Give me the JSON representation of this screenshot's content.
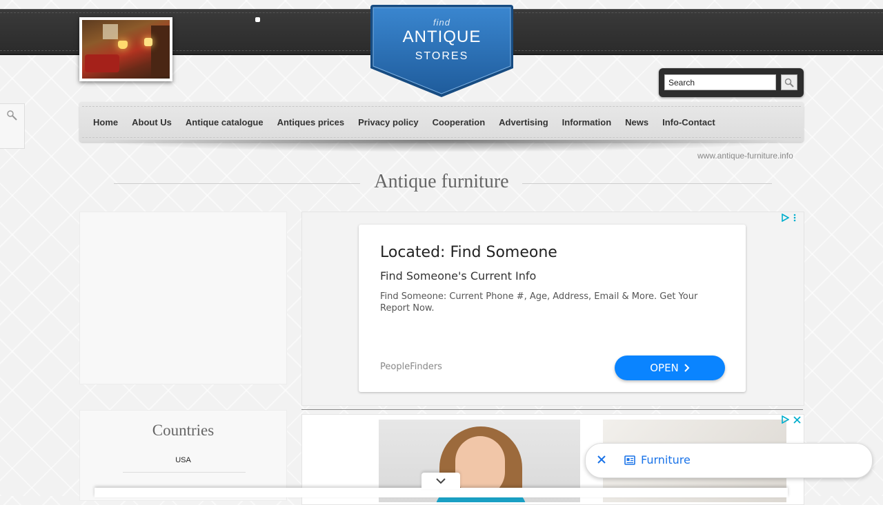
{
  "logo": {
    "find": "find",
    "antique": "ANTIQUE",
    "stores": "STORES"
  },
  "search": {
    "value": "Search"
  },
  "nav": {
    "items": [
      "Home",
      "About Us",
      "Antique catalogue",
      "Antiques prices",
      "Privacy policy",
      "Cooperation",
      "Advertising",
      "Information",
      "News",
      "Info-Contact"
    ]
  },
  "site_url": "www.antique-furniture.info",
  "page_title": "Antique furniture",
  "sidebar": {
    "countries_title": "Countries",
    "countries": [
      "USA"
    ]
  },
  "ad": {
    "headline": "Located: Find Someone",
    "subheadline": "Find Someone's Current Info",
    "description": "Find Someone: Current Phone #, Age, Address, Email & More. Get Your Report Now.",
    "advertiser": "PeopleFinders",
    "cta": "OPEN"
  },
  "suggestion": {
    "label": "Furniture"
  },
  "colors": {
    "logo_blue": "#2a6fb3",
    "cta_blue": "#0a84ff",
    "link_blue": "#1a73e8",
    "adchoices": "#00aecd"
  }
}
